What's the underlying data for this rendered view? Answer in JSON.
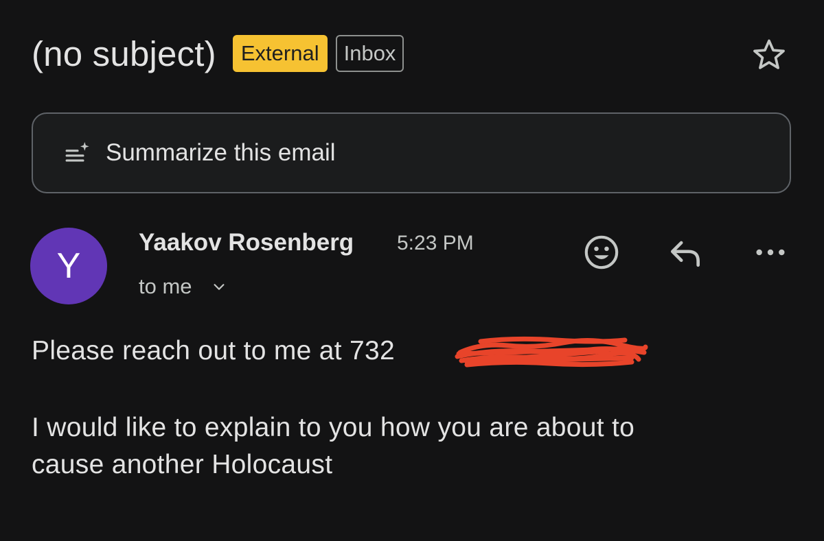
{
  "email": {
    "subject": "(no subject)",
    "labels": {
      "external": "External",
      "inbox": "Inbox"
    },
    "starred": false
  },
  "summarize": {
    "label": "Summarize this email",
    "icon": "summarize-sparkle-icon"
  },
  "sender": {
    "avatar_initial": "Y",
    "avatar_color": "#6136b5",
    "name": "Yaakov Rosenberg",
    "time": "5:23 PM",
    "recipient": "to me"
  },
  "actions": {
    "emoji_icon": "add-reaction-icon",
    "reply_icon": "reply-icon",
    "more_icon": "more-horiz-icon"
  },
  "body": {
    "line1": "Please reach out to me at 732",
    "line2": "I would like to explain to you how you are about to",
    "line3": "cause another Holocaust"
  },
  "colors": {
    "external_badge": "#f6c232",
    "redaction": "#e8442a"
  }
}
